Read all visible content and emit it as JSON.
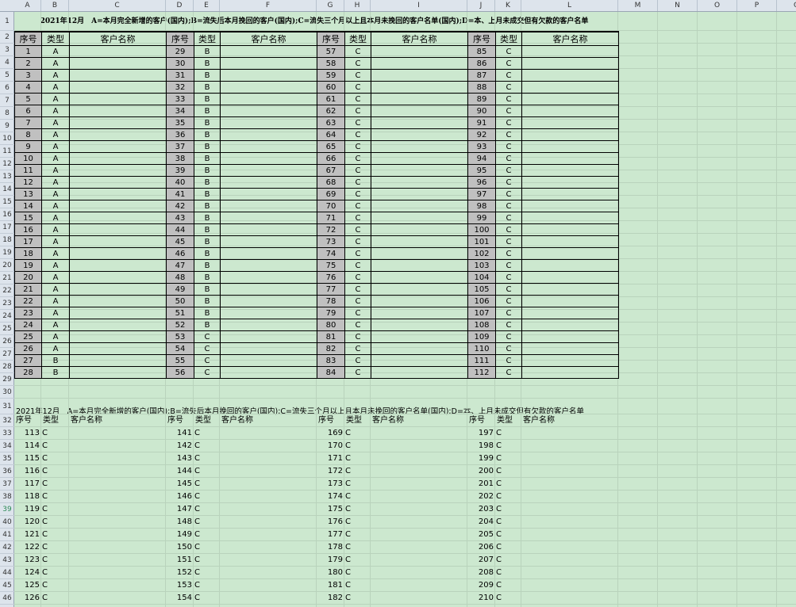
{
  "columns": [
    "A",
    "B",
    "C",
    "D",
    "E",
    "F",
    "G",
    "H",
    "I",
    "J",
    "K",
    "L",
    "M",
    "N",
    "O",
    "P",
    "Q"
  ],
  "row_numbers": [
    1,
    2,
    3,
    4,
    5,
    6,
    7,
    8,
    9,
    10,
    11,
    12,
    13,
    14,
    15,
    16,
    17,
    18,
    19,
    20,
    21,
    22,
    23,
    24,
    25,
    26,
    27,
    28,
    29,
    30,
    31,
    32,
    33,
    34,
    35,
    36,
    37,
    38,
    39,
    40,
    41,
    42,
    43,
    44,
    45,
    46
  ],
  "selected_row": 39,
  "title": "2021年12月　A=本月完全新增的客户(国内);B=流失后本月挽回的客户(国内);C=流失三个月以上且本月未挽回的客户名单(国内);D=本、上月未成交但有欠款的客户名单",
  "headers": {
    "seq": "序号",
    "type": "类型",
    "name": "客户名称"
  },
  "blocks": [
    {
      "seq": [
        "1",
        "2",
        "3",
        "4",
        "5",
        "6",
        "7",
        "8",
        "9",
        "10",
        "11",
        "12",
        "13",
        "14",
        "15",
        "16",
        "17",
        "18",
        "19",
        "20",
        "21",
        "22",
        "23",
        "24",
        "25",
        "26",
        "27",
        "28"
      ],
      "type": [
        "A",
        "A",
        "A",
        "A",
        "A",
        "A",
        "A",
        "A",
        "A",
        "A",
        "A",
        "A",
        "A",
        "A",
        "A",
        "A",
        "A",
        "A",
        "A",
        "A",
        "A",
        "A",
        "A",
        "A",
        "A",
        "A",
        "B",
        "B"
      ]
    },
    {
      "seq": [
        "29",
        "30",
        "31",
        "32",
        "33",
        "34",
        "35",
        "36",
        "37",
        "38",
        "39",
        "40",
        "41",
        "42",
        "43",
        "44",
        "45",
        "46",
        "47",
        "48",
        "49",
        "50",
        "51",
        "52",
        "53",
        "54",
        "55",
        "56"
      ],
      "type": [
        "B",
        "B",
        "B",
        "B",
        "B",
        "B",
        "B",
        "B",
        "B",
        "B",
        "B",
        "B",
        "B",
        "B",
        "B",
        "B",
        "B",
        "B",
        "B",
        "B",
        "B",
        "B",
        "B",
        "B",
        "C",
        "C",
        "C",
        "C"
      ]
    },
    {
      "seq": [
        "57",
        "58",
        "59",
        "60",
        "61",
        "62",
        "63",
        "64",
        "65",
        "66",
        "67",
        "68",
        "69",
        "70",
        "71",
        "72",
        "73",
        "74",
        "75",
        "76",
        "77",
        "78",
        "79",
        "80",
        "81",
        "82",
        "83",
        "84"
      ],
      "type": [
        "C",
        "C",
        "C",
        "C",
        "C",
        "C",
        "C",
        "C",
        "C",
        "C",
        "C",
        "C",
        "C",
        "C",
        "C",
        "C",
        "C",
        "C",
        "C",
        "C",
        "C",
        "C",
        "C",
        "C",
        "C",
        "C",
        "C",
        "C"
      ]
    },
    {
      "seq": [
        "85",
        "86",
        "87",
        "88",
        "89",
        "90",
        "91",
        "92",
        "93",
        "94",
        "95",
        "96",
        "97",
        "98",
        "99",
        "100",
        "101",
        "102",
        "103",
        "104",
        "105",
        "106",
        "107",
        "108",
        "109",
        "110",
        "111",
        "112"
      ],
      "type": [
        "C",
        "C",
        "C",
        "C",
        "C",
        "C",
        "C",
        "C",
        "C",
        "C",
        "C",
        "C",
        "C",
        "C",
        "C",
        "C",
        "C",
        "C",
        "C",
        "C",
        "C",
        "C",
        "C",
        "C",
        "C",
        "C",
        "C",
        "C"
      ]
    }
  ],
  "lower_blocks": [
    {
      "seq": [
        "113",
        "114",
        "115",
        "116",
        "117",
        "118",
        "119",
        "120",
        "121",
        "122",
        "123",
        "124",
        "125",
        "126"
      ],
      "type": "C"
    },
    {
      "seq": [
        "141",
        "142",
        "143",
        "144",
        "145",
        "146",
        "147",
        "148",
        "149",
        "150",
        "151",
        "152",
        "153",
        "154"
      ],
      "type": "C"
    },
    {
      "seq": [
        "169",
        "170",
        "171",
        "172",
        "173",
        "174",
        "175",
        "176",
        "177",
        "178",
        "179",
        "180",
        "181",
        "182"
      ],
      "type": "C"
    },
    {
      "seq": [
        "197",
        "198",
        "199",
        "200",
        "201",
        "202",
        "203",
        "204",
        "205",
        "206",
        "207",
        "208",
        "209",
        "210"
      ],
      "type": "C"
    }
  ]
}
